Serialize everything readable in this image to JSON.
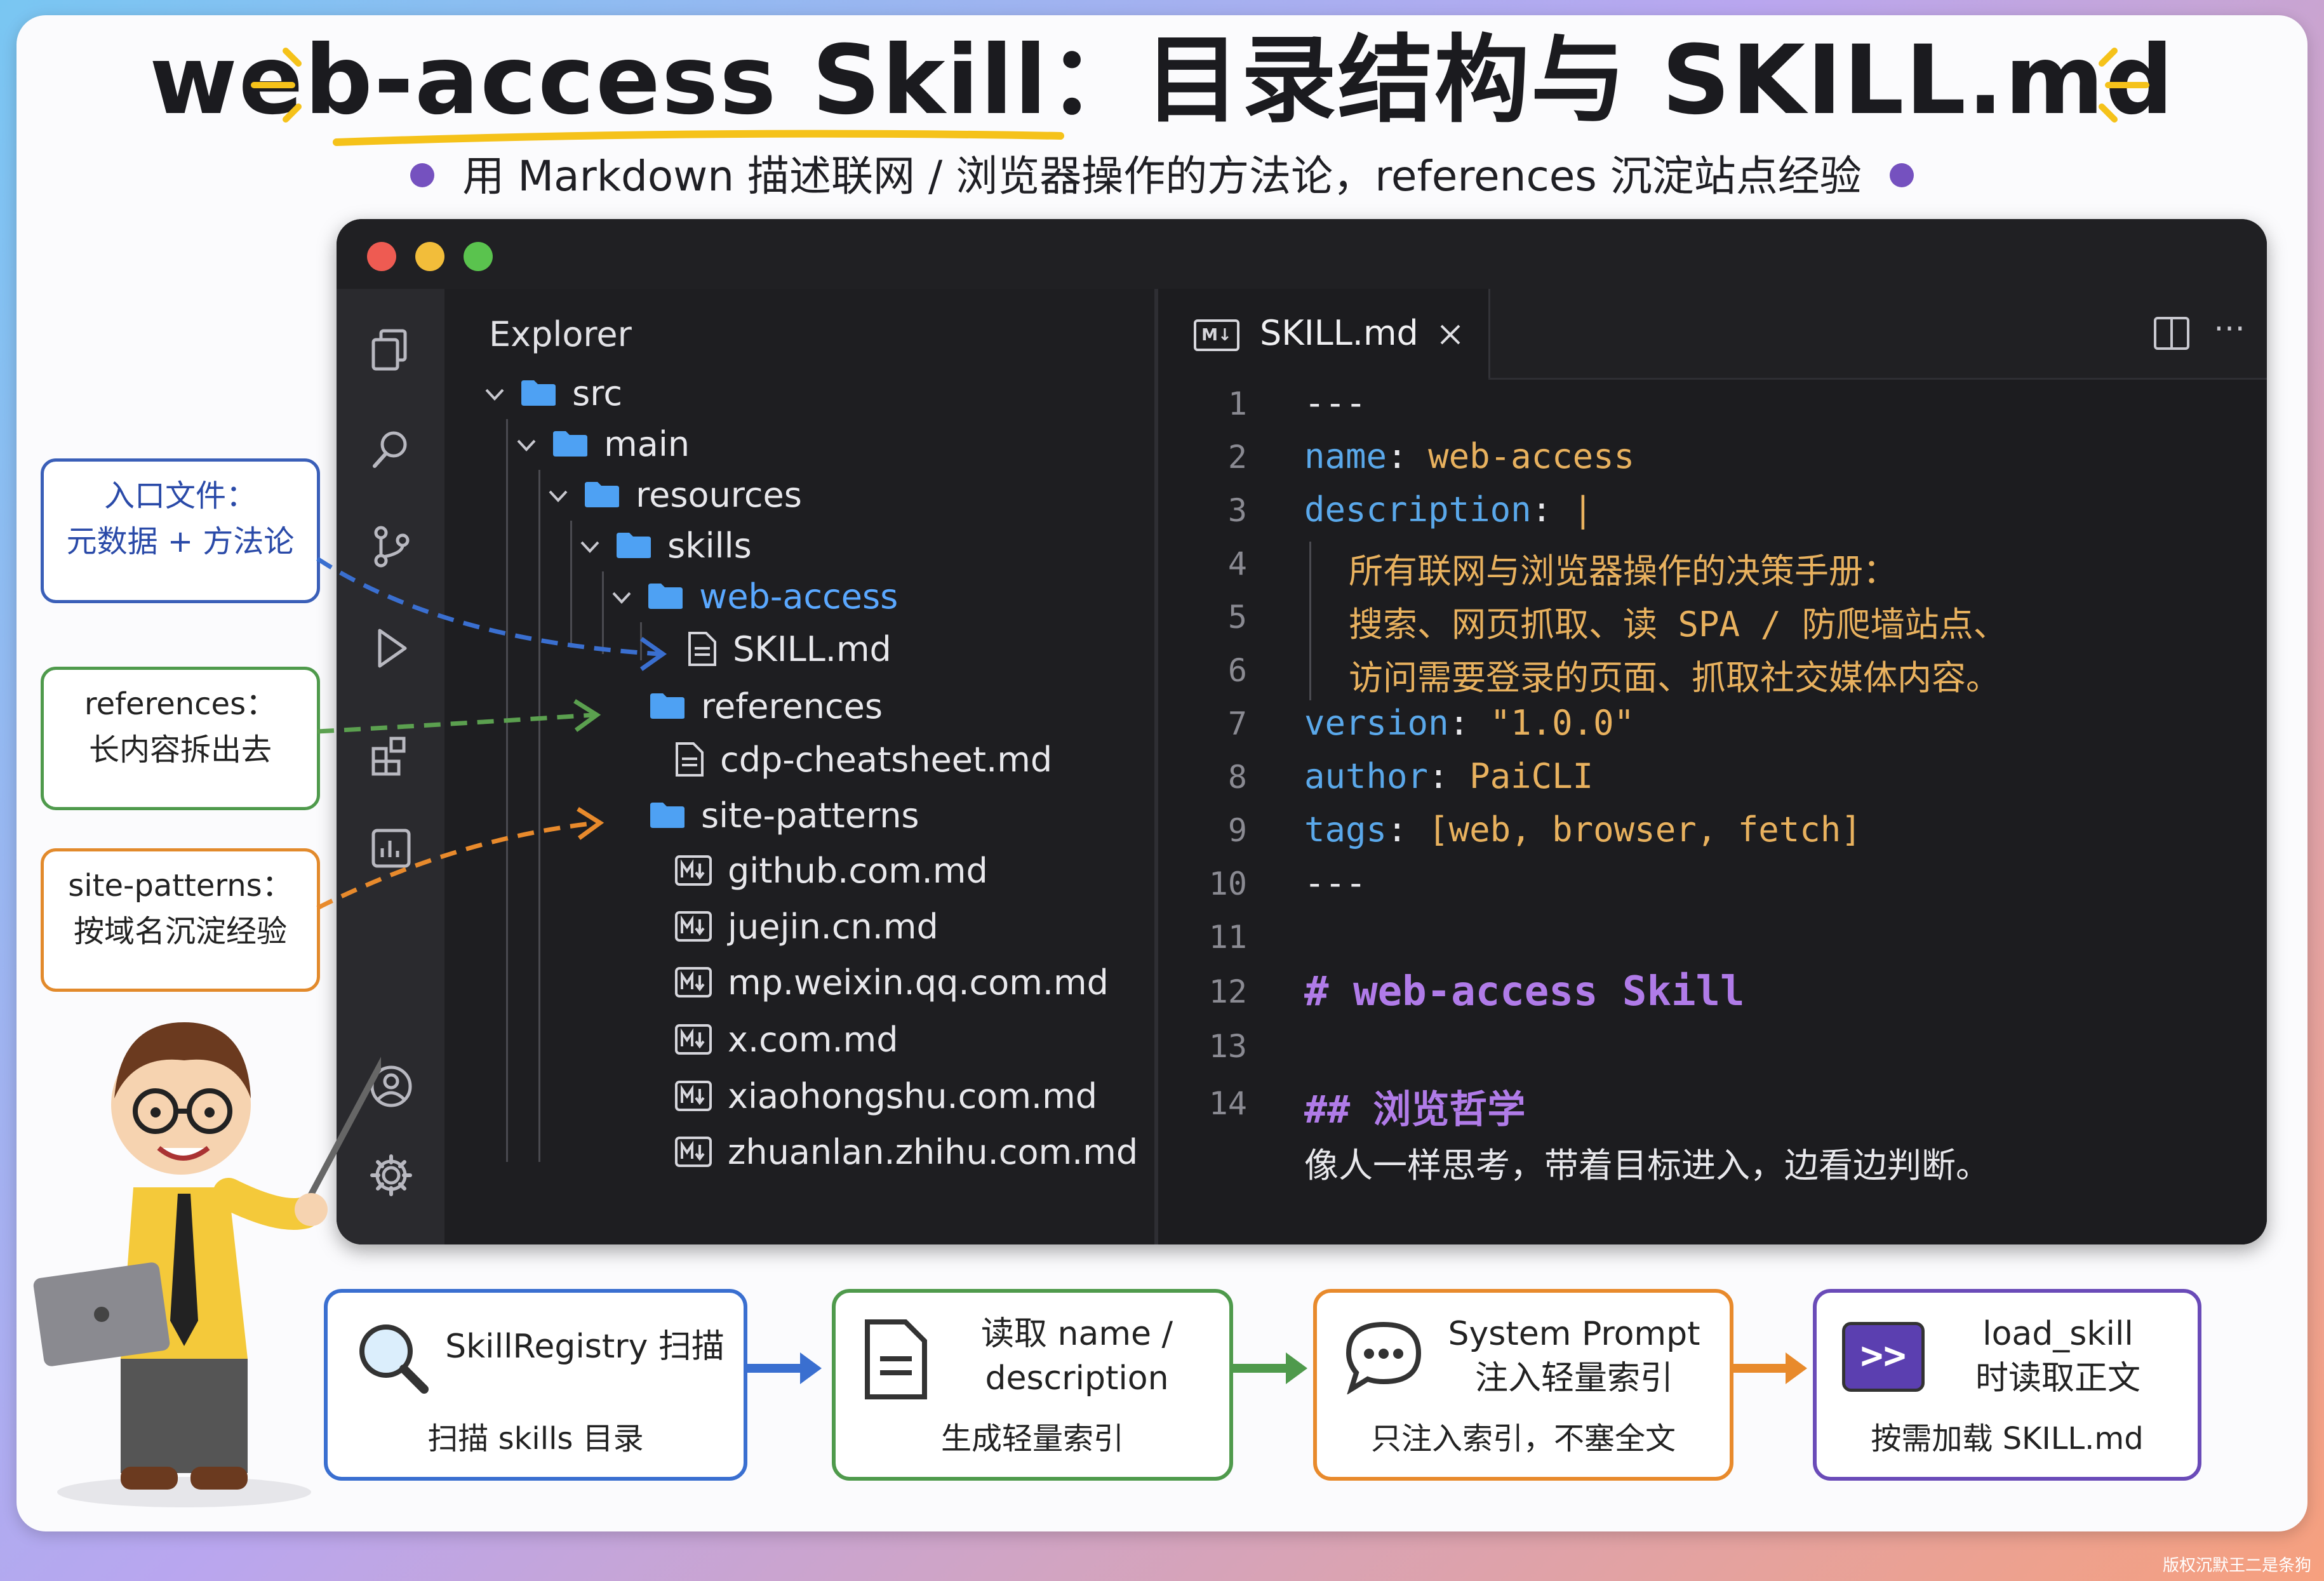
{
  "title": "web-access Skill：目录结构与 SKILL.md",
  "subtitle": "用 Markdown 描述联网 / 浏览器操作的方法论，references 沉淀站点经验",
  "explorer": {
    "title": "Explorer",
    "items": [
      {
        "label": "src"
      },
      {
        "label": "main"
      },
      {
        "label": "resources"
      },
      {
        "label": "skills"
      },
      {
        "label": "web-access"
      },
      {
        "label": "SKILL.md"
      },
      {
        "label": "references"
      },
      {
        "label": "cdp-cheatsheet.md"
      },
      {
        "label": "site-patterns"
      },
      {
        "label": "github.com.md"
      },
      {
        "label": "juejin.cn.md"
      },
      {
        "label": "mp.weixin.qq.com.md"
      },
      {
        "label": "x.com.md"
      },
      {
        "label": "xiaohongshu.com.md"
      },
      {
        "label": "zhuanlan.zhihu.com.md"
      }
    ]
  },
  "editor": {
    "tab_label": "SKILL.md",
    "tab_icon": "M↓",
    "line_numbers": [
      "1",
      "2",
      "3",
      "4",
      "5",
      "6",
      "7",
      "8",
      "9",
      "10",
      "11",
      "12",
      "13",
      "14"
    ],
    "lines": {
      "l1": "---",
      "l2_key": "name",
      "l2_val": "web-access",
      "l3_key": "description",
      "l3_val": "|",
      "l4": "所有联网与浏览器操作的决策手册：",
      "l5": "搜索、网页抓取、读 SPA / 防爬墙站点、",
      "l6": "访问需要登录的页面、抓取社交媒体内容。",
      "l7_key": "version",
      "l7_val": "\"1.0.0\"",
      "l8_key": "author",
      "l8_val": "PaiCLI",
      "l9_key": "tags",
      "l9_val": "[web, browser, fetch]",
      "l10": "---",
      "l12": "# web-access Skill",
      "l14": "## 浏览哲学",
      "l15": "像人一样思考，带着目标进入，边看边判断。"
    },
    "colon": ":"
  },
  "callouts": [
    {
      "line1": "入口文件：",
      "line2": "元数据 + 方法论",
      "color": "#3a5fb8"
    },
    {
      "line1": "references：",
      "line2": "长内容拆出去",
      "color": "#4f9a4c"
    },
    {
      "line1": "site-patterns：",
      "line2": "按域名沉淀经验",
      "color": "#e28a2c"
    }
  ],
  "flow": [
    {
      "title": "SkillRegistry 扫描",
      "sub": "扫描 skills 目录",
      "icon": "magnifier-icon",
      "color": "#3a6fd0"
    },
    {
      "title1": "读取 name /",
      "title2": "description",
      "sub": "生成轻量索引",
      "icon": "document-icon",
      "color": "#4f9a4c"
    },
    {
      "title1": "System Prompt",
      "title2": "注入轻量索引",
      "sub": "只注入索引，不塞全文",
      "icon": "chat-bubble-icon",
      "color": "#e88a2c"
    },
    {
      "title1": "load_skill",
      "title2": "时读取正文",
      "sub": "按需加载 SKILL.md",
      "icon": "terminal-icon",
      "icon_text": ">>",
      "color": "#6a4bb8"
    }
  ],
  "watermark": "版权沉默王二是条狗"
}
